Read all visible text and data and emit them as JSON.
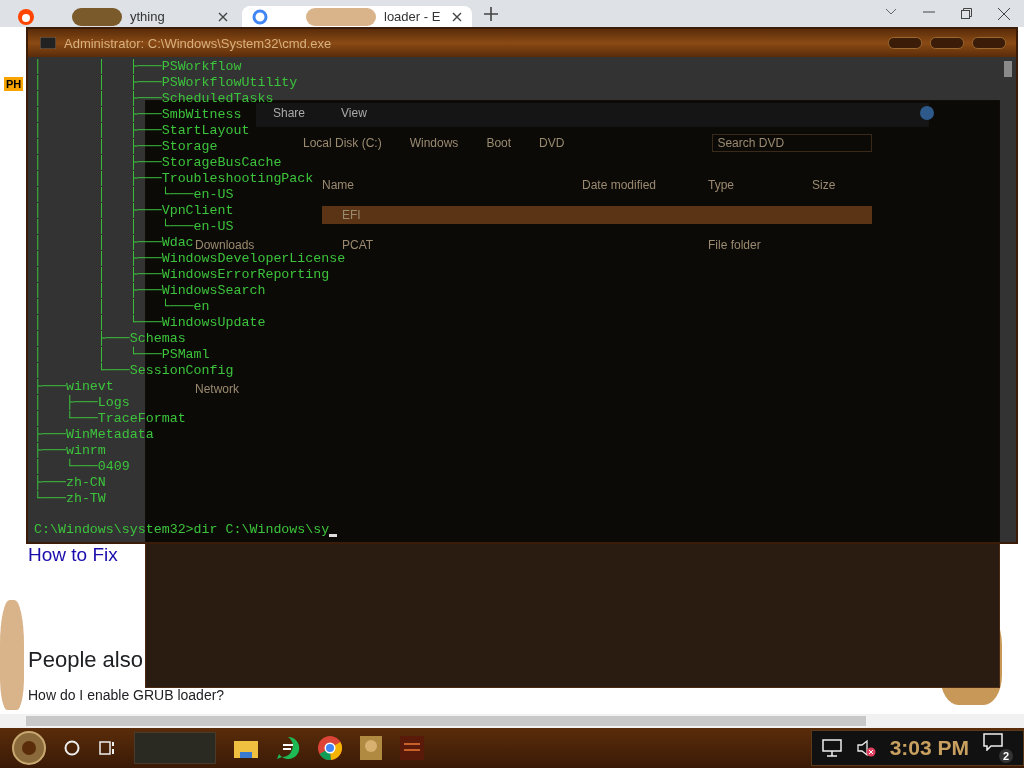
{
  "browser": {
    "tabs": [
      {
        "title": "ything",
        "selected": false
      },
      {
        "title": "loader - E",
        "selected": true
      }
    ],
    "page": {
      "badge": "PH",
      "heading": "How to Fix",
      "section": "People also",
      "question": "How do I enable GRUB loader?"
    }
  },
  "explorer": {
    "menu": [
      "Share",
      "View"
    ],
    "path": [
      "Local Disk (C:)",
      "Windows",
      "Boot",
      "DVD"
    ],
    "search_placeholder": "Search DVD",
    "columns": [
      "Name",
      "Date modified",
      "Type",
      "Size"
    ],
    "rows": [
      {
        "name": "EFI",
        "selected": true
      },
      {
        "name": "PCAT",
        "type": "File folder",
        "selected": false
      }
    ],
    "nav": [
      "Downloads",
      "Network"
    ]
  },
  "cmd": {
    "title": "Administrator: C:\\Windows\\System32\\cmd.exe",
    "lines": [
      "│       │   ├───PSWorkflow",
      "│       │   ├───PSWorkflowUtility",
      "│       │   ├───ScheduledTasks",
      "│       │   ├───SmbWitness",
      "│       │   ├───StartLayout",
      "│       │   ├───Storage",
      "│       │   ├───StorageBusCache",
      "│       │   ├───TroubleshootingPack",
      "│       │   │   └───en-US",
      "│       │   ├───VpnClient",
      "│       │   │   └───en-US",
      "│       │   ├───Wdac",
      "│       │   ├───WindowsDeveloperLicense",
      "│       │   ├───WindowsErrorReporting",
      "│       │   ├───WindowsSearch",
      "│       │   │   └───en",
      "│       │   └───WindowsUpdate",
      "│       ├───Schemas",
      "│       │   └───PSMaml",
      "│       └───SessionConfig",
      "├───winevt",
      "│   ├───Logs",
      "│   └───TraceFormat",
      "├───WinMetadata",
      "├───winrm",
      "│   └───0409",
      "├───zh-CN",
      "└───zh-TW"
    ],
    "prompt": "C:\\Windows\\system32>dir C:\\Windows\\sy"
  },
  "taskbar": {
    "speaker_muted": true,
    "clock": "3:03 PM",
    "notifications": "2"
  }
}
